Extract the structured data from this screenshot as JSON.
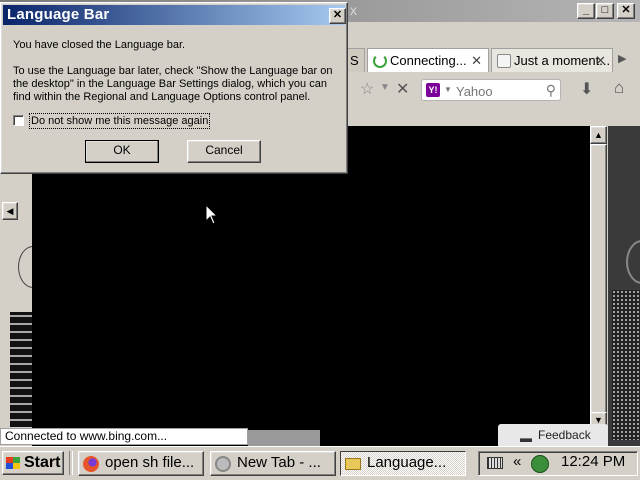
{
  "browser": {
    "title_fragment": "x",
    "window_controls": {
      "minimize": "_",
      "maximize": "□",
      "close": "✕"
    },
    "tabs": [
      {
        "label": "S",
        "closable": false
      },
      {
        "label": "Connecting...",
        "close": "✕"
      },
      {
        "label": "Just a moment...",
        "close": "✕"
      }
    ],
    "search": {
      "engine": "Yahoo",
      "placeholder": "Yahoo",
      "logo": "Y!"
    },
    "status": "Connected to www.bing.com...",
    "feedback": "Feedback"
  },
  "dialog": {
    "title": "Language Bar",
    "close": "✕",
    "message1": "You have closed the Language bar.",
    "message2": "To use the Language bar later, check \"Show the Language bar on the desktop\" in the Language Bar Settings dialog, which you can find within the Regional and Language Options control panel.",
    "checkbox_label": "Do not show me this message again",
    "checkbox_checked": false,
    "ok": "OK",
    "cancel": "Cancel"
  },
  "taskbar": {
    "start": "Start",
    "tasks": [
      {
        "label": "open sh file...",
        "icon": "firefox-icon"
      },
      {
        "label": "New Tab - ...",
        "icon": "chrome-icon"
      },
      {
        "label": "Language...",
        "icon": "folder-icon",
        "active": true
      }
    ],
    "tray_expand": "«",
    "clock": "12:24 PM"
  },
  "colors": {
    "dialog_title_start": "#0a246a",
    "dialog_title_end": "#a6caf0",
    "face": "#d4d0c8",
    "content": "#000000"
  }
}
